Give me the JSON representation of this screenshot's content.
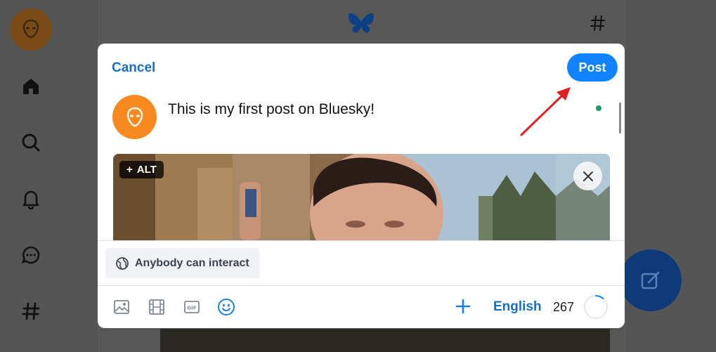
{
  "app": {
    "name": "Bluesky"
  },
  "composer": {
    "cancel_label": "Cancel",
    "post_label": "Post",
    "post_text": "This is my first post on Bluesky!",
    "alt_label": "ALT",
    "alt_prefix": "+",
    "interaction_label": "Anybody can interact",
    "language": "English",
    "char_remaining": "267",
    "char_used_fraction": 0.11
  },
  "toolbar": {
    "icons": [
      "image-icon",
      "video-icon",
      "gif-icon",
      "emoji-icon"
    ]
  },
  "colors": {
    "accent": "#1083fe",
    "link": "#1a6fc2",
    "avatar": "#f7891f",
    "annotation_arrow": "#e02020"
  }
}
